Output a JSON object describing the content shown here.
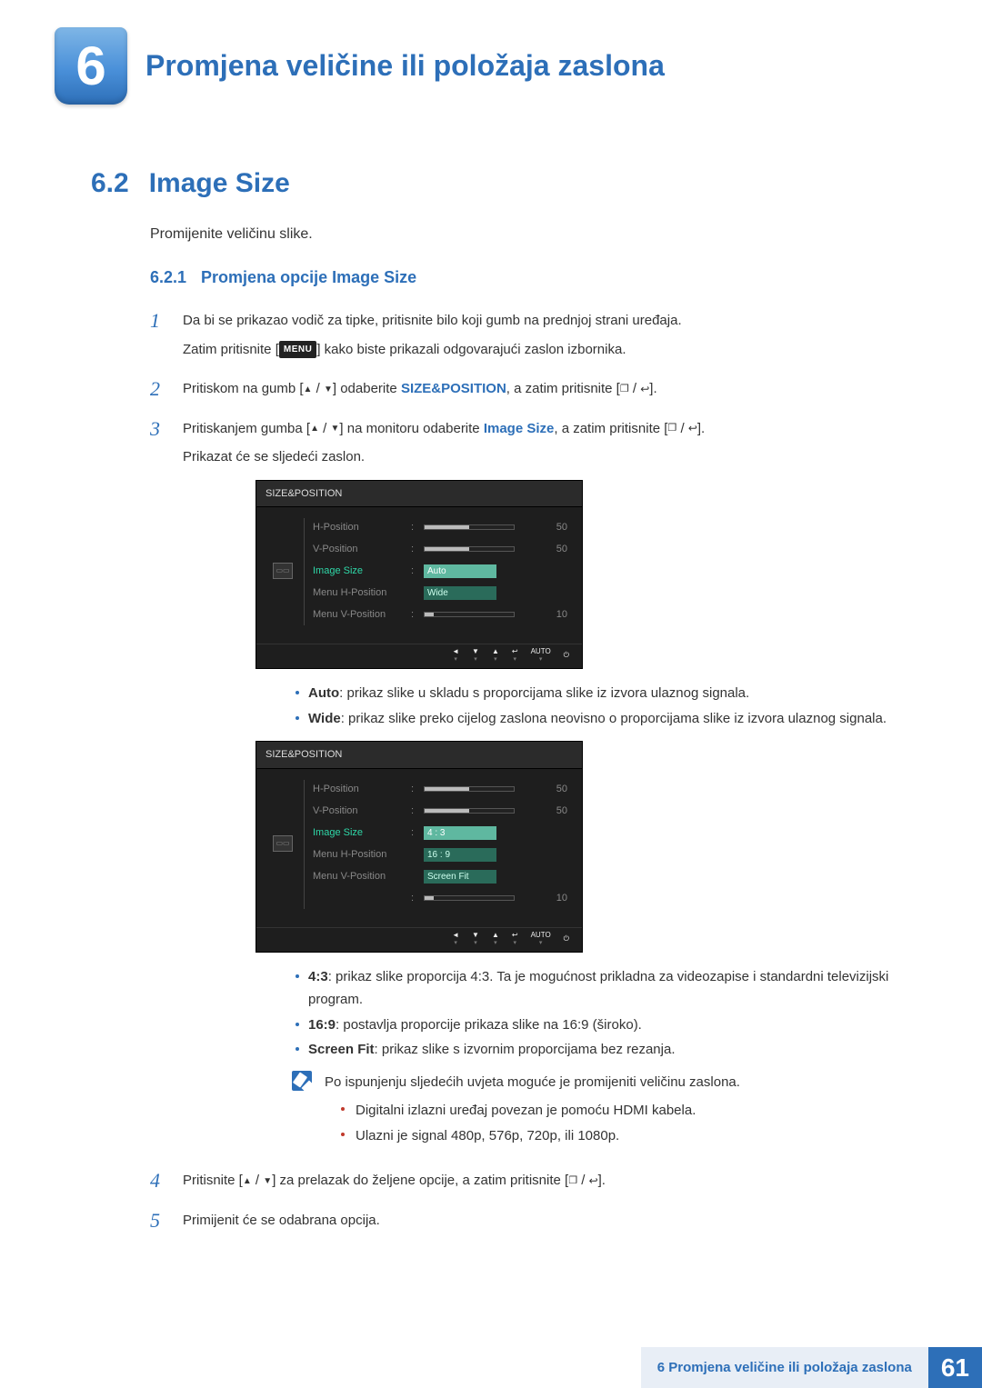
{
  "chapter": {
    "number": "6",
    "title": "Promjena veličine ili položaja zaslona"
  },
  "section": {
    "number": "6.2",
    "title": "Image Size",
    "intro": "Promijenite veličinu slike."
  },
  "subsection": {
    "number": "6.2.1",
    "title": "Promjena opcije Image Size"
  },
  "steps": {
    "s1": {
      "num": "1",
      "line1": "Da bi se prikazao vodič za tipke, pritisnite bilo koji gumb na prednjoj strani uređaja.",
      "line2a": "Zatim pritisnite [",
      "menu": "MENU",
      "line2b": "] kako biste prikazali odgovarajući zaslon izbornika."
    },
    "s2": {
      "num": "2",
      "a": "Pritiskom na gumb [",
      "b": "] odaberite ",
      "kw": "SIZE&POSITION",
      "c": ", a zatim pritisnite [",
      "d": "]."
    },
    "s3": {
      "num": "3",
      "a": "Pritiskanjem gumba [",
      "b": "] na monitoru odaberite ",
      "kw": "Image Size",
      "c": ", a zatim pritisnite [",
      "d": "].",
      "e": "Prikazat će se sljedeći zaslon."
    },
    "s4": {
      "num": "4",
      "a": "Pritisnite [",
      "b": "] za prelazak do željene opcije, a zatim pritisnite [",
      "c": "]."
    },
    "s5": {
      "num": "5",
      "text": "Primijenit će se odabrana opcija."
    }
  },
  "osd1": {
    "title": "SIZE&POSITION",
    "rows": [
      {
        "label": "H-Position",
        "value": "50",
        "fill": 50
      },
      {
        "label": "V-Position",
        "value": "50",
        "fill": 50
      },
      {
        "label": "Image Size",
        "selected": true,
        "options": [
          "Auto",
          "Wide"
        ]
      },
      {
        "label": "Menu H-Position"
      },
      {
        "label": "Menu V-Position",
        "value": "10",
        "fill": 10
      }
    ],
    "footer": [
      "◄",
      "▼",
      "▲",
      "↩",
      "AUTO",
      "⏻"
    ]
  },
  "osd2": {
    "title": "SIZE&POSITION",
    "rows": [
      {
        "label": "H-Position",
        "value": "50",
        "fill": 50
      },
      {
        "label": "V-Position",
        "value": "50",
        "fill": 50
      },
      {
        "label": "Image Size",
        "selected": true,
        "options": [
          "4 : 3",
          "16 : 9",
          "Screen Fit"
        ]
      },
      {
        "label": "Menu H-Position"
      },
      {
        "label": "Menu V-Position",
        "value": "10",
        "fill": 10
      }
    ],
    "footer": [
      "◄",
      "▼",
      "▲",
      "↩",
      "AUTO",
      "⏻"
    ]
  },
  "bullets1": {
    "auto": {
      "label": "Auto",
      "text": ": prikaz slike u skladu s proporcijama slike iz izvora ulaznog signala."
    },
    "wide": {
      "label": "Wide",
      "text": ": prikaz slike preko cijelog zaslona neovisno o proporcijama slike iz izvora ulaznog signala."
    }
  },
  "bullets2": {
    "r43": {
      "label": "4:3",
      "text": ": prikaz slike proporcija 4:3. Ta je mogućnost prikladna za videozapise i standardni televizijski program."
    },
    "r169": {
      "label": "16:9",
      "text": ": postavlja proporcije prikaza slike na 16:9 (široko)."
    },
    "fit": {
      "label": "Screen Fit",
      "text": ": prikaz slike s izvornim proporcijama bez rezanja."
    }
  },
  "note": {
    "lead": "Po ispunjenju sljedećih uvjeta moguće je promijeniti veličinu zaslona.",
    "items": [
      "Digitalni izlazni uređaj povezan je pomoću HDMI kabela.",
      "Ulazni je signal 480p, 576p, 720p, ili 1080p."
    ]
  },
  "footer": {
    "text": "6 Promjena veličine ili položaja zaslona",
    "page": "61"
  }
}
